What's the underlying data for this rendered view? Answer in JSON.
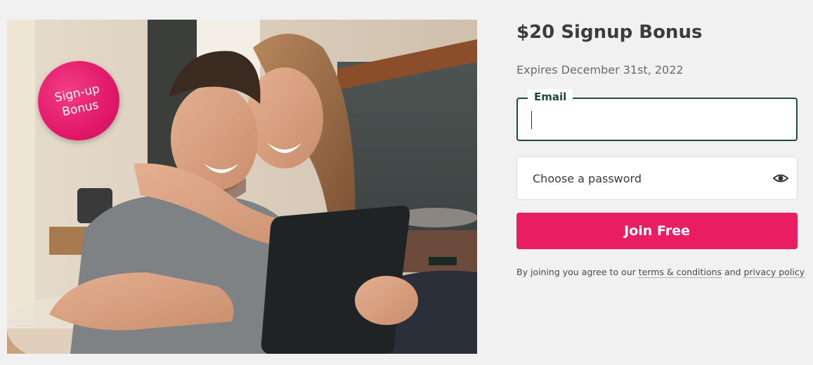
{
  "photo": {
    "badge_text": "Sign-up Bonus"
  },
  "offer": {
    "title": "$20 Signup Bonus",
    "expires": "Expires December 31st, 2022"
  },
  "form": {
    "email_label": "Email",
    "email_value": "",
    "password_placeholder": "Choose a password",
    "show_password_icon": "eye-icon",
    "join_label": "Join Free"
  },
  "terms": {
    "prefix": "By joining you agree to our",
    "terms_link": "terms & conditions",
    "conjunction": "and",
    "privacy_link": "privacy policy"
  },
  "colors": {
    "accent": "#e81d62",
    "field_focus": "#1d4b34",
    "background": "#f1f1f1"
  }
}
